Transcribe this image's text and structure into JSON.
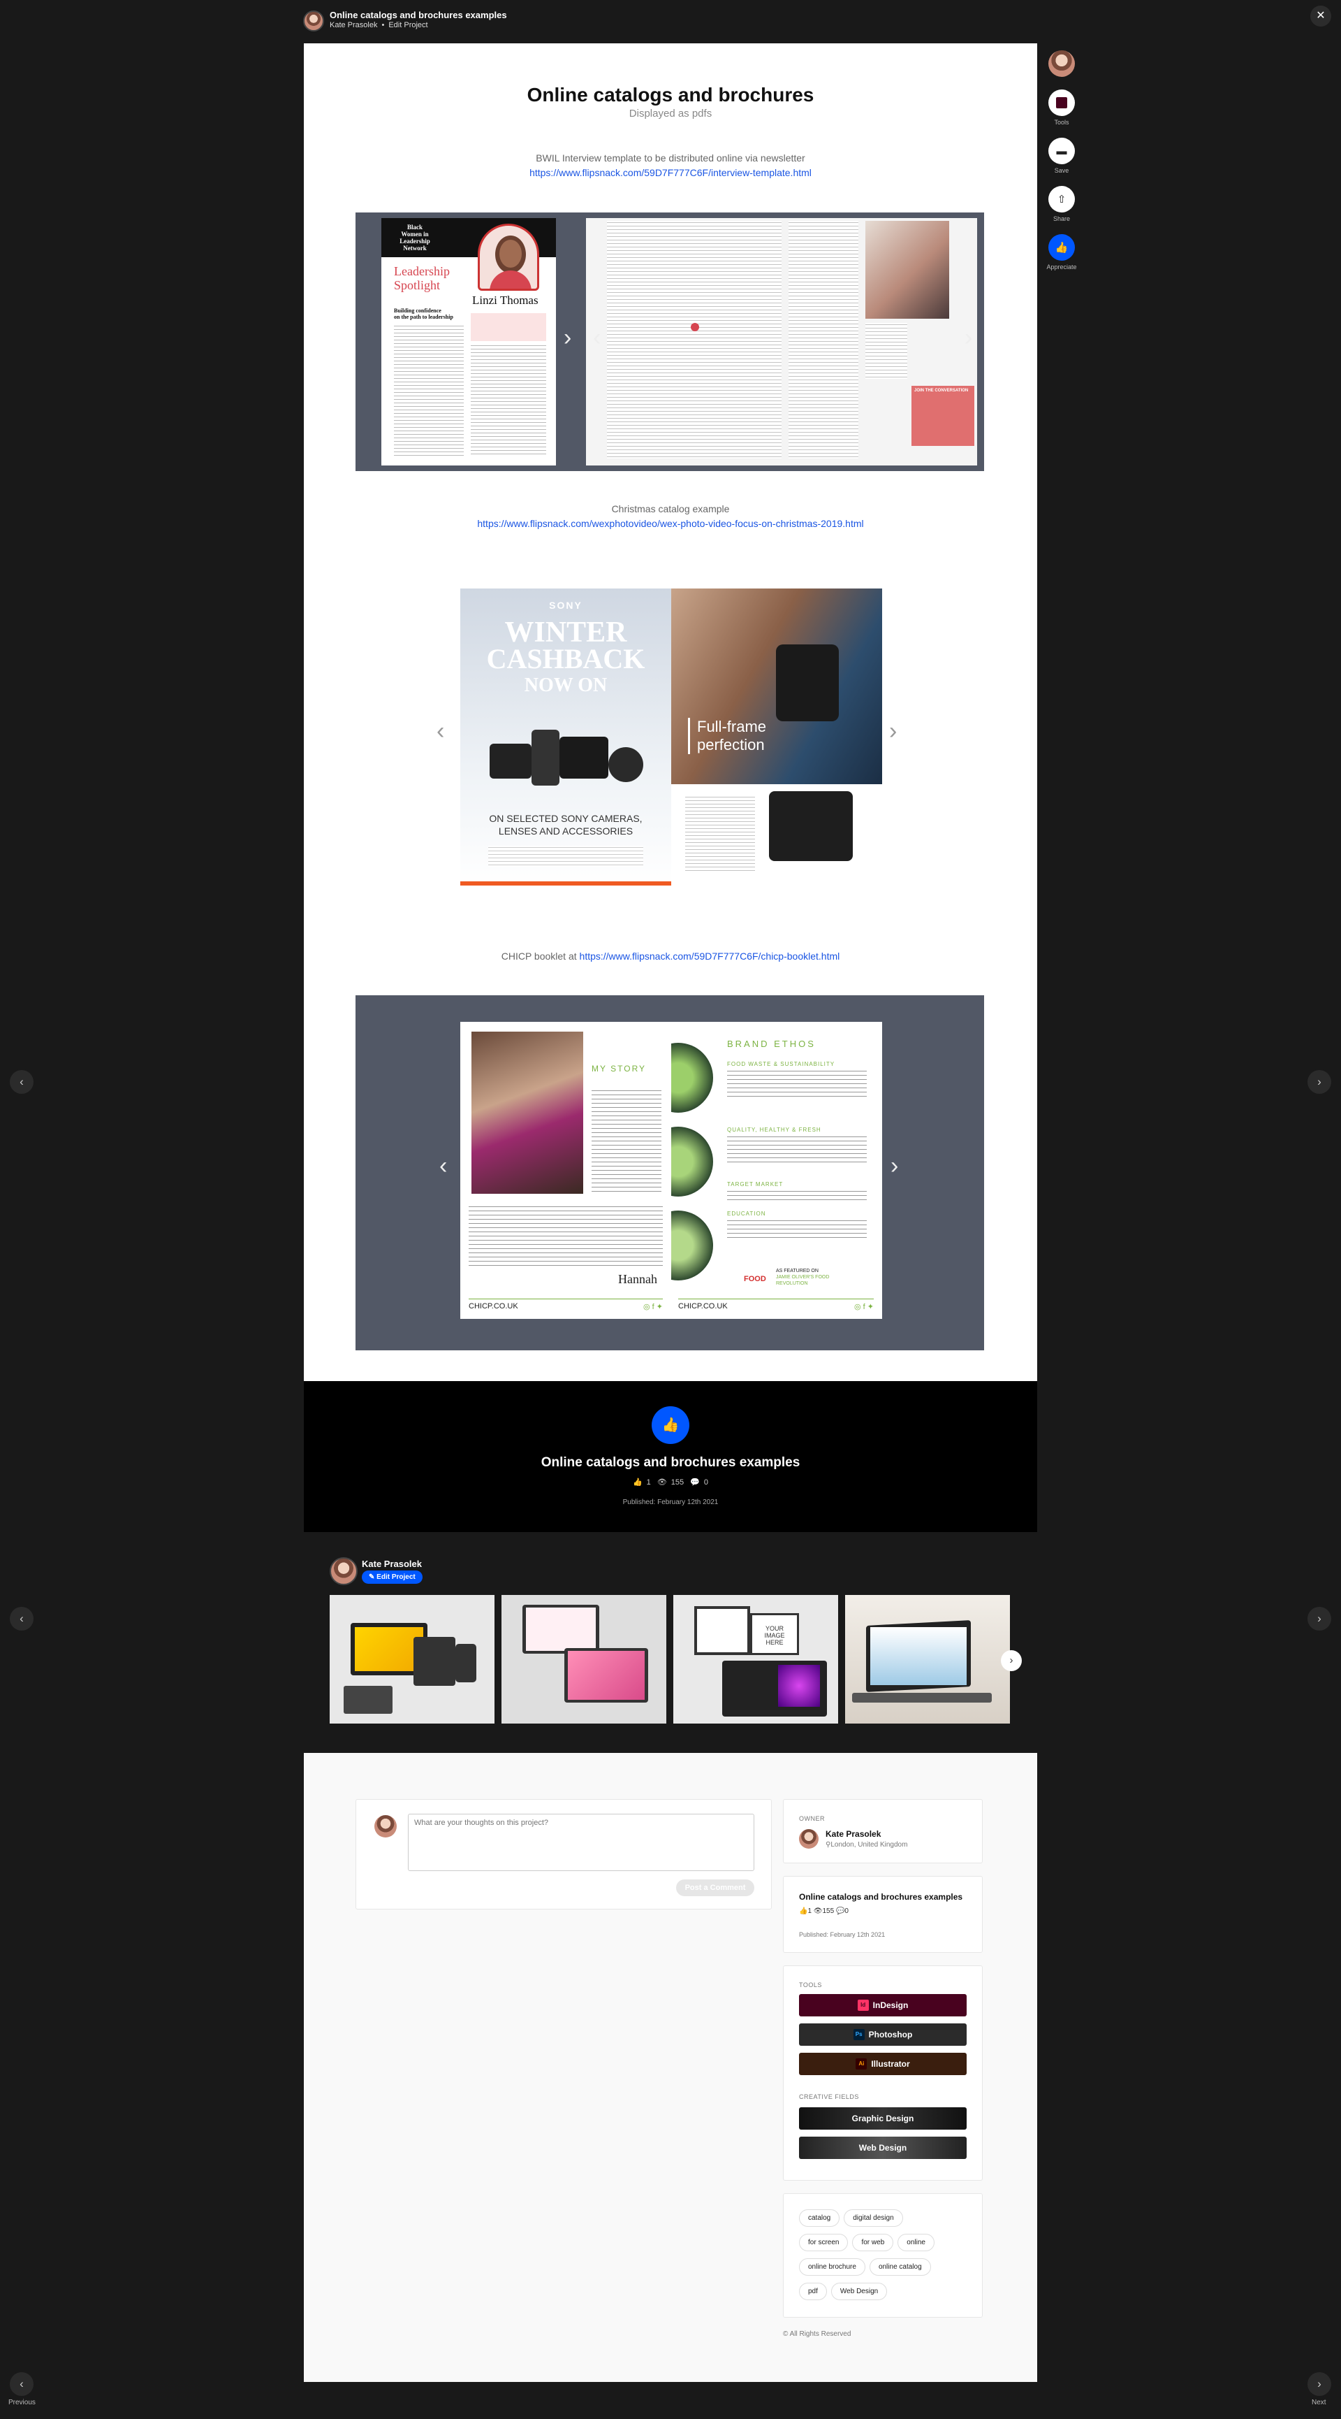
{
  "header": {
    "title": "Online catalogs and brochures examples",
    "owner": "Kate Prasolek",
    "edit_link": "Edit Project",
    "close_icon": "close-icon"
  },
  "rail": {
    "tools_label": "Tools",
    "save_label": "Save",
    "share_label": "Share",
    "appreciate_label": "Appreciate"
  },
  "nav": {
    "previous_label": "Previous",
    "next_label": "Next"
  },
  "project": {
    "title": "Online catalogs and brochures",
    "subtitle": "Displayed as pdfs",
    "section1_caption": "BWIL Interview template to be distributed online via newsletter",
    "section1_link": "https://www.flipsnack.com/59D7F777C6F/interview-template.html",
    "section2_caption": "Christmas catalog example",
    "section2_link": "https://www.flipsnack.com/wexphotovideo/wex-photo-video-focus-on-christmas-2019.html",
    "section3_caption": "CHICP booklet at",
    "section3_link": "https://www.flipsnack.com/59D7F777C6F/chicp-booklet.html"
  },
  "bwil": {
    "org1": "Black",
    "org2": "Women in",
    "org3": "Leadership",
    "org4": "Network",
    "heading1": "Leadership",
    "heading2": "Spotlight",
    "name": "Linzi Thomas",
    "subhead1": "Building confidence",
    "subhead2": "on the path to leadership",
    "join1": "JOIN THE CONVERSATION"
  },
  "sony": {
    "brand": "SONY",
    "h1": "WINTER",
    "h2": "CASHBACK",
    "h3": "NOW ON",
    "sub1": "ON SELECTED SONY CAMERAS,",
    "sub2": "LENSES AND ACCESSORIES",
    "tag1": "Full-frame",
    "tag2": "perfection"
  },
  "chicp": {
    "my_story": "MY STORY",
    "brand_ethos": "BRAND ETHOS",
    "e1": "FOOD WASTE & SUSTAINABILITY",
    "e2": "QUALITY, HEALTHY & FRESH",
    "e3": "TARGET MARKET",
    "e4": "EDUCATION",
    "signature": "Hannah",
    "site_left": "CHICP.CO.UK",
    "site_right": "CHICP.CO.UK",
    "featured1": "AS FEATURED ON",
    "featured2": "JAMIE OLIVER'S FOOD",
    "featured3": "REVOLUTION",
    "logo": "FOOD"
  },
  "band": {
    "title": "Online catalogs and brochures examples",
    "likes": "1",
    "views": "155",
    "comments": "0",
    "published": "Published: February 12th 2021"
  },
  "owner_strip": {
    "name": "Kate Prasolek",
    "edit": "Edit Project"
  },
  "comments": {
    "placeholder": "What are your thoughts on this project?",
    "post": "Post a Comment"
  },
  "sidebar": {
    "owner_label": "OWNER",
    "owner_name": "Kate Prasolek",
    "owner_location": "London, United Kingdom",
    "project_title": "Online catalogs and brochures examples",
    "likes": "1",
    "views": "155",
    "comments": "0",
    "published": "Published: February 12th 2021",
    "tools_label": "TOOLS",
    "tools": [
      {
        "name": "InDesign",
        "abbr": "Id",
        "bg": "#49021f",
        "icon": "#ff3366"
      },
      {
        "name": "Photoshop",
        "abbr": "Ps",
        "bg": "#2b2b2b",
        "icon": "#31a8ff"
      },
      {
        "name": "Illustrator",
        "abbr": "Ai",
        "bg": "#3a1e0e",
        "icon": "#ff9a00"
      }
    ],
    "fields_label": "CREATIVE FIELDS",
    "fields": [
      "Graphic Design",
      "Web Design"
    ],
    "tags": [
      "catalog",
      "digital design",
      "for screen",
      "for web",
      "online",
      "online brochure",
      "online catalog",
      "pdf",
      "Web Design"
    ],
    "copyright": "© All Rights Reserved"
  },
  "colors": {
    "accent": "#0057ff",
    "link": "#1a55e3",
    "viewer_bg": "#525866"
  }
}
